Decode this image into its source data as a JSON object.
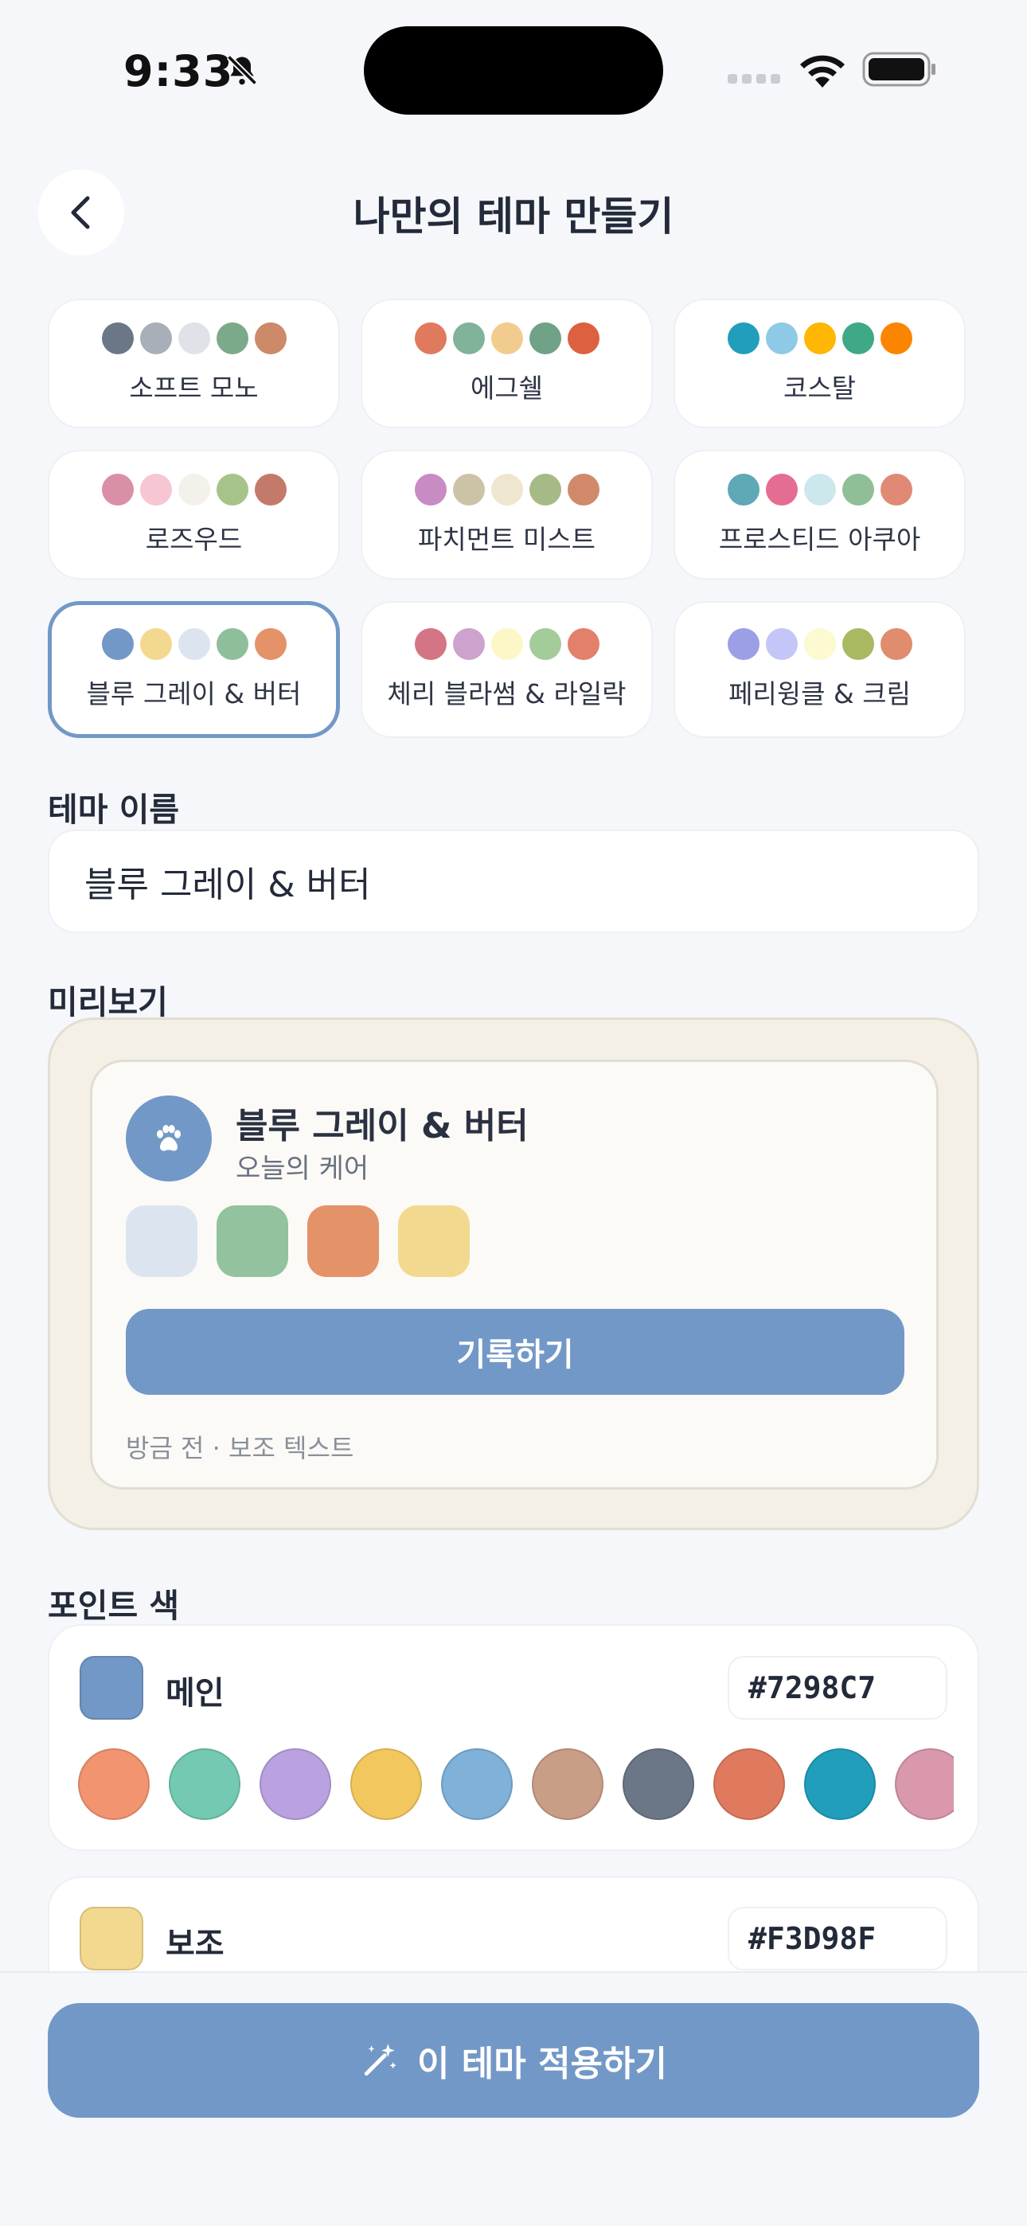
{
  "status": {
    "time": "9:33"
  },
  "header": {
    "title": "나만의 테마 만들기"
  },
  "presets": [
    {
      "label": "소프트 모노",
      "colors": [
        "#6B7787",
        "#A8AFB8",
        "#DFE3E8",
        "#7BAA8A",
        "#CC8A68"
      ]
    },
    {
      "label": "에그쉘",
      "colors": [
        "#E07A5F",
        "#81B29A",
        "#F2CC8F",
        "#6FA287",
        "#DD6040"
      ]
    },
    {
      "label": "코스탈",
      "colors": [
        "#219EBC",
        "#8ECAE6",
        "#FFB703",
        "#3FA987",
        "#FB8500"
      ]
    },
    {
      "label": "로즈우드",
      "colors": [
        "#D98FA6",
        "#F6C6D3",
        "#F4F1EA",
        "#A6C48A",
        "#C47A6B"
      ]
    },
    {
      "label": "파치먼트 미스트",
      "colors": [
        "#C98BC4",
        "#CCC3A6",
        "#EFE6CF",
        "#A6BA86",
        "#D08A6A"
      ]
    },
    {
      "label": "프로스티드 아쿠아",
      "colors": [
        "#5FA8B5",
        "#E56D92",
        "#CDE8ED",
        "#90BF97",
        "#E08A76"
      ]
    },
    {
      "label": "블루 그레이 & 버터",
      "colors": [
        "#7298C7",
        "#F3D98F",
        "#DCE5EF",
        "#8FBF9A",
        "#E49268"
      ],
      "selected": true
    },
    {
      "label": "체리 블라썸 & 라일락",
      "colors": [
        "#D47585",
        "#CDA2CC",
        "#FDF7C8",
        "#A4CC9A",
        "#E2806A"
      ]
    },
    {
      "label": "페리윙클 & 크림",
      "colors": [
        "#9C9FE6",
        "#C3C6F6",
        "#FDF9D0",
        "#A9B962",
        "#E08C6E"
      ]
    }
  ],
  "theme_name": {
    "label": "테마 이름",
    "value": "블루 그레이 & 버터"
  },
  "preview": {
    "label": "미리보기",
    "title": "블루 그레이 & 버터",
    "subtitle": "오늘의 케어",
    "swatches": [
      "#DCE5EF",
      "#93C29F",
      "#E49268",
      "#F3D98F"
    ],
    "button_label": "기록하기",
    "meta": "방금 전 · 보조 텍스트",
    "accent": "#7298C7",
    "background": "#F4F0E6"
  },
  "point_colors": {
    "label": "포인트 색",
    "main": {
      "label": "메인",
      "hex": "#7298C7",
      "color": "#7298C7"
    },
    "palette": [
      "#F29470",
      "#73C9B1",
      "#B9A2DF",
      "#F2C85E",
      "#7FB1D9",
      "#C99E86",
      "#6B7787",
      "#E07A5F",
      "#219EBC",
      "#D998AB"
    ],
    "sub": {
      "label": "보조",
      "hex": "#F3D98F",
      "color": "#F3D98F"
    }
  },
  "apply_button": {
    "label": "이 테마 적용하기"
  }
}
